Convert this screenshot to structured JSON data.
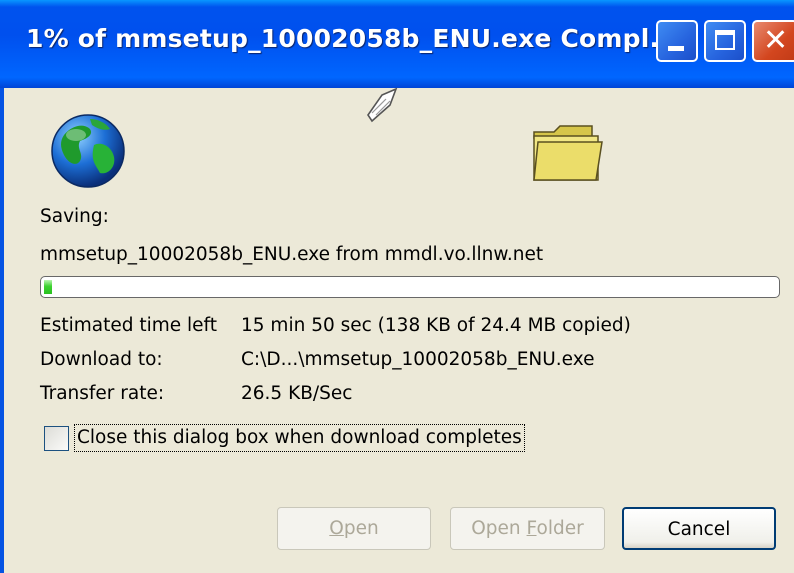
{
  "window": {
    "title": "1% of mmsetup_10002058b_ENU.exe Compl...",
    "controls": {
      "minimize": "minimize-icon",
      "maximize": "maximize-icon",
      "close": "close-icon"
    }
  },
  "icons": {
    "source": "globe-icon",
    "transfer": "paper-icon",
    "destination": "folder-icon"
  },
  "status": {
    "saving_label": "Saving:",
    "saving_detail": "mmsetup_10002058b_ENU.exe from mmdl.vo.llnw.net"
  },
  "progress": {
    "percent": 1
  },
  "details": {
    "time_label": "Estimated time left",
    "time_value": "15 min 50 sec (138 KB of 24.4 MB copied)",
    "download_label": "Download to:",
    "download_value": "C:\\D...\\mmsetup_10002058b_ENU.exe",
    "rate_label": "Transfer rate:",
    "rate_value": "26.5 KB/Sec"
  },
  "checkbox": {
    "checked": false,
    "label": "Close this dialog box when download completes"
  },
  "buttons": {
    "open_rest": "pen",
    "open_key": "O",
    "open_folder_pre": "Open ",
    "open_folder_key": "F",
    "open_folder_rest": "older",
    "cancel": "Cancel"
  },
  "colors": {
    "titlebar": "#0054e3",
    "window_bg": "#ece9d8",
    "progress": "#2ac01f"
  }
}
